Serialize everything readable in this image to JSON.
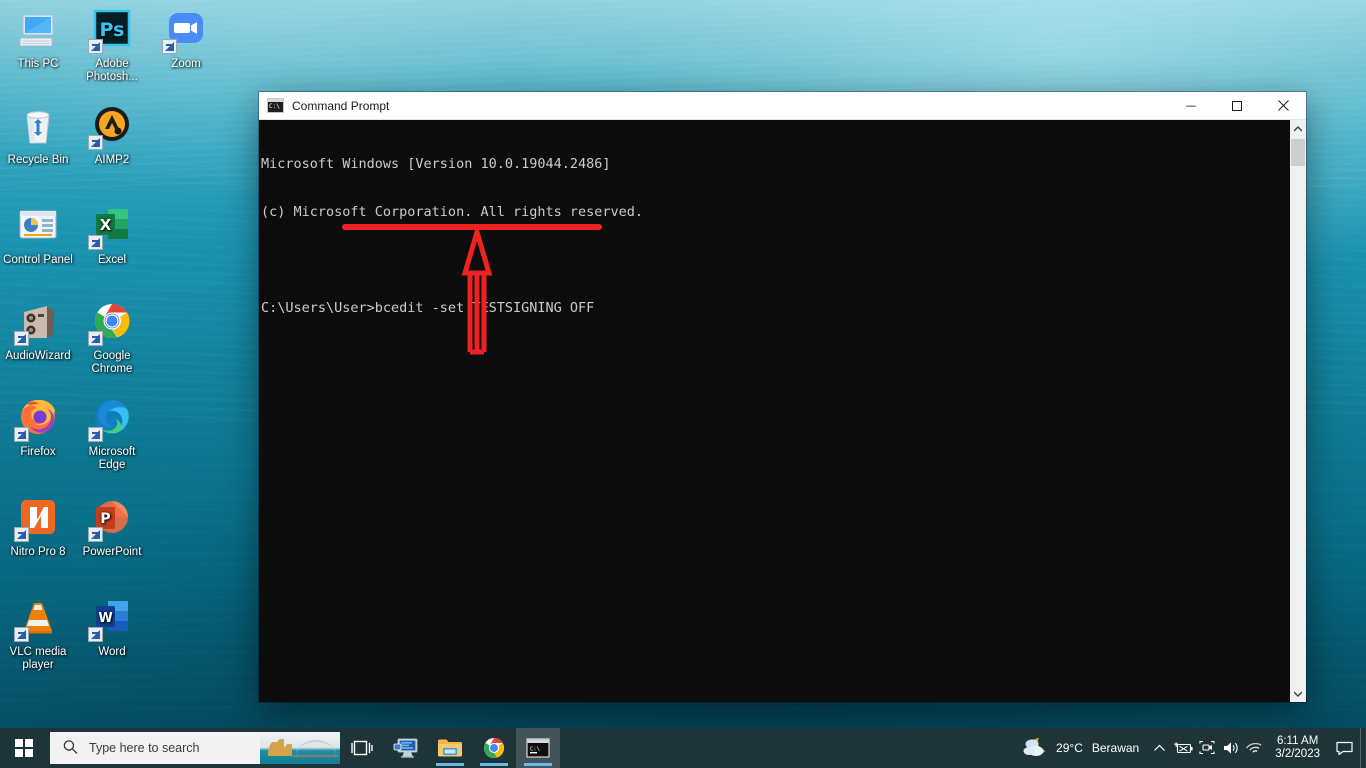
{
  "desktop": {
    "icons": [
      {
        "label": "This PC",
        "icon": "this-pc-icon",
        "shortcut": false
      },
      {
        "label": "Adobe Photosh...",
        "icon": "adobe-photoshop-icon",
        "shortcut": true
      },
      {
        "label": "Zoom",
        "icon": "zoom-icon",
        "shortcut": true
      },
      {
        "label": "Recycle Bin",
        "icon": "recycle-bin-icon",
        "shortcut": false
      },
      {
        "label": "AIMP2",
        "icon": "aimp2-icon",
        "shortcut": true
      },
      {
        "label": "Control Panel",
        "icon": "control-panel-icon",
        "shortcut": false
      },
      {
        "label": "Excel",
        "icon": "excel-icon",
        "shortcut": true
      },
      {
        "label": "AudioWizard",
        "icon": "audiowizard-icon",
        "shortcut": true
      },
      {
        "label": "Google Chrome",
        "icon": "google-chrome-icon",
        "shortcut": true
      },
      {
        "label": "Firefox",
        "icon": "firefox-icon",
        "shortcut": true
      },
      {
        "label": "Microsoft Edge",
        "icon": "microsoft-edge-icon",
        "shortcut": true
      },
      {
        "label": "Nitro Pro 8",
        "icon": "nitro-pro-icon",
        "shortcut": true
      },
      {
        "label": "PowerPoint",
        "icon": "powerpoint-icon",
        "shortcut": true
      },
      {
        "label": "VLC media player",
        "icon": "vlc-icon",
        "shortcut": true
      },
      {
        "label": "Word",
        "icon": "word-icon",
        "shortcut": true
      }
    ]
  },
  "cmd_window": {
    "title": "Command Prompt",
    "app_icon": "command-prompt-icon",
    "minimize_label": "—",
    "maximize_label": "☐",
    "close_label": "✕",
    "console_lines": [
      "Microsoft Windows [Version 10.0.19044.2486]",
      "(c) Microsoft Corporation. All rights reserved.",
      "",
      "C:\\Users\\User>bcedit -set TESTSIGNING OFF"
    ],
    "scrollbar": {
      "up_arrow": "▲",
      "down_arrow": "▼"
    },
    "annotation": {
      "type": "arrow-underline",
      "color": "#ee2222",
      "points_to": "C:\\Users\\User>bcedit -set TESTSIGNING OFF"
    }
  },
  "taskbar": {
    "start_label": "Start",
    "search": {
      "placeholder": "Type here to search",
      "icon": "search-icon",
      "thumbnail": "sydney-opera-house-thumbnail"
    },
    "buttons": [
      {
        "name": "task-view-button",
        "icon": "task-view-icon",
        "running": false,
        "active": false
      },
      {
        "name": "remote-desktop-button",
        "icon": "remote-desktop-icon",
        "running": false,
        "active": false
      },
      {
        "name": "file-explorer-button",
        "icon": "file-explorer-icon",
        "running": true,
        "active": false
      },
      {
        "name": "google-chrome-button",
        "icon": "google-chrome-icon",
        "running": true,
        "active": false
      },
      {
        "name": "command-prompt-button",
        "icon": "command-prompt-icon",
        "running": true,
        "active": true
      }
    ],
    "weather": {
      "icon": "partly-cloudy-night-icon",
      "temperature": "29°C",
      "condition": "Berawan"
    },
    "tray_icons": [
      {
        "name": "show-hidden-icons-button",
        "glyph": "∧"
      },
      {
        "name": "battery-charging-icon",
        "glyph": "⚡"
      },
      {
        "name": "webcam-icon",
        "glyph": "⌑"
      },
      {
        "name": "volume-icon",
        "glyph": "🔊"
      },
      {
        "name": "wifi-icon",
        "glyph": "◠"
      }
    ],
    "clock": {
      "time": "6:11 AM",
      "date": "3/2/2023"
    },
    "action_center_icon": "action-center-icon"
  },
  "colors": {
    "taskbar_bg": "#1f3438",
    "console_bg": "#0c0c0c",
    "console_fg": "#cccccc",
    "annotation_red": "#ee2222",
    "accent_blue": "#6ab8e8"
  }
}
